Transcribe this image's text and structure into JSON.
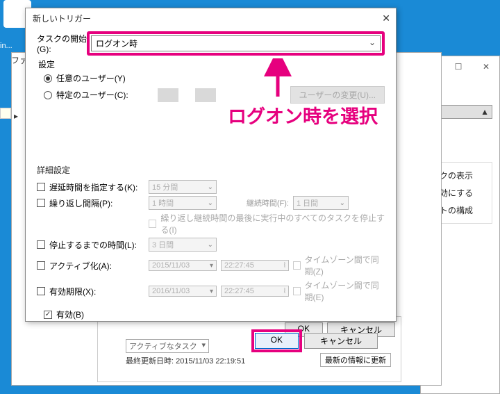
{
  "desktop": {
    "icon_label": "in..."
  },
  "bgwin": {
    "file_menu": "ファ...",
    "dd_text": "...",
    "panel_items": [
      "スクの表示",
      "有効にする",
      "ットの構成"
    ],
    "arrow": "▲",
    "dots": "..."
  },
  "dialog": {
    "title": "新しいトリガー",
    "task_begin_label": "タスクの開始(G):",
    "task_begin_value": "ログオン時",
    "settings_label": "設定",
    "radio_any_user": "任意のユーザー(Y)",
    "radio_specific_user": "特定のユーザー(C):",
    "change_user_btn": "ユーザーの変更(U)...",
    "adv_label": "詳細設定",
    "delay_label": "遅延時間を指定する(K):",
    "delay_value": "15 分間",
    "repeat_label": "繰り返し間隔(P):",
    "repeat_value": "1 時間",
    "duration_label": "継続時間(F):",
    "duration_value": "1 日間",
    "stop_all_label": "繰り返し継続時間の最後に実行中のすべてのタスクを停止する(I)",
    "stop_after_label": "停止するまでの時間(L):",
    "stop_after_value": "3 日間",
    "activate_label": "アクティブ化(A):",
    "activate_date": "2015/11/03",
    "activate_time": "22:27:45",
    "tz_sync_z": "タイムゾーン間で同期(Z)",
    "expire_label": "有効期限(X):",
    "expire_date": "2016/11/03",
    "expire_time": "22:27:45",
    "tz_sync_e": "タイムゾーン間で同期(E)",
    "enabled_label": "有効(B)",
    "ok": "OK",
    "cancel": "キャンセル"
  },
  "callout": "ログオン時を選択",
  "bgwin2": {
    "file_line": "ファ...",
    "dd": "アクティブなタスク",
    "last_update": "最終更新日時: 2015/11/03 22:19:51",
    "refresh": "最新の情報に更新",
    "ok": "OK",
    "cancel": "キャンセル"
  },
  "glyph": {
    "chev_down": "⌄",
    "close": "✕",
    "min": "—",
    "max": "☐",
    "tri": "▾",
    "arrow_right": "▸"
  }
}
